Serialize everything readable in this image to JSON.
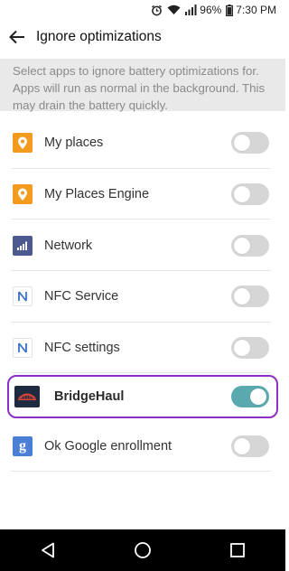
{
  "status_bar": {
    "battery_percent": "96%",
    "time": "7:30 PM",
    "icons": [
      "alarm-icon",
      "wifi-icon",
      "signal-icon",
      "battery-icon"
    ]
  },
  "header": {
    "title": "Ignore optimizations",
    "back_icon": "back-arrow-icon"
  },
  "description": "Select apps to ignore battery optimizations for. Apps will run as normal in the background. This may drain the battery quickly.",
  "apps": [
    {
      "label": "My places",
      "icon": "location-pin-icon",
      "enabled": false
    },
    {
      "label": "My Places Engine",
      "icon": "location-pin-icon",
      "enabled": false
    },
    {
      "label": "Network",
      "icon": "signal-bars-icon",
      "enabled": false
    },
    {
      "label": "NFC Service",
      "icon": "nfc-icon",
      "enabled": false
    },
    {
      "label": "NFC settings",
      "icon": "nfc-icon",
      "enabled": false
    },
    {
      "label": "BridgeHaul",
      "icon": "bridgehaul-logo-icon",
      "enabled": true,
      "highlighted": true
    },
    {
      "label": "Ok Google enrollment",
      "icon": "google-g-icon",
      "enabled": false
    }
  ],
  "nav_bar": {
    "buttons": [
      "back-triangle-icon",
      "home-circle-icon",
      "recents-square-icon"
    ]
  },
  "colors": {
    "switch_on": "#5aa9ae",
    "switch_off": "#d6d6d6",
    "highlight_border": "#8d2fc4",
    "description_bg": "#e9e9e9",
    "location_icon": "#f29b1d",
    "google_icon": "#4a7fd6",
    "network_icon": "#4d5a8f"
  }
}
